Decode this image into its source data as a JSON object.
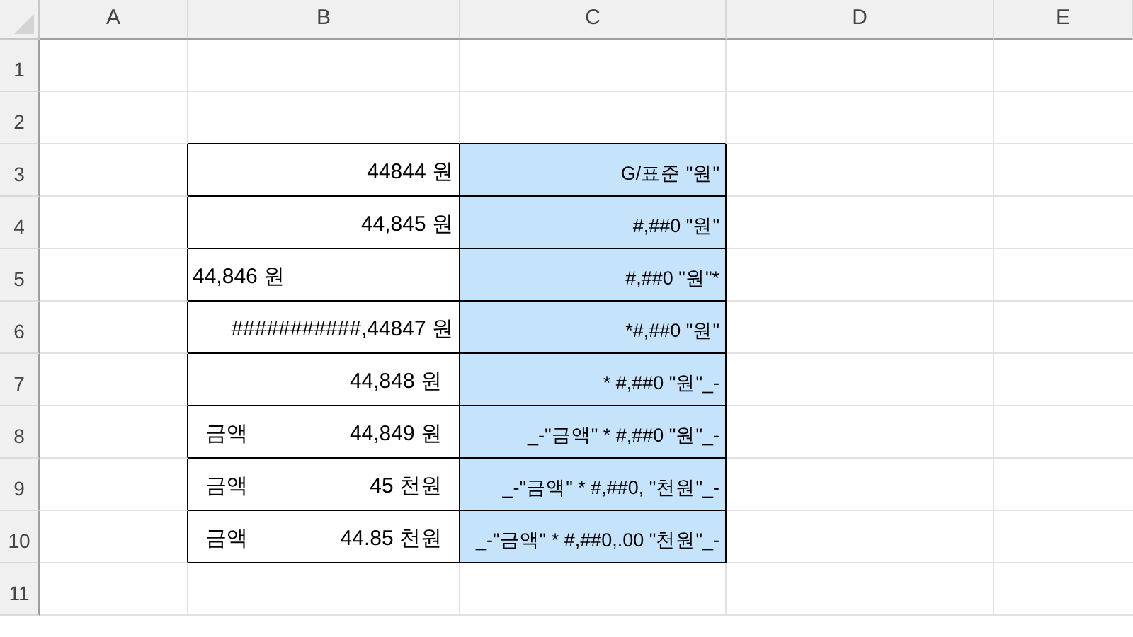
{
  "columns": [
    "A",
    "B",
    "C",
    "D",
    "E"
  ],
  "rows": [
    {
      "number": "1"
    },
    {
      "number": "2"
    },
    {
      "number": "3",
      "b": {
        "kind": "right",
        "text": "44844 원"
      },
      "c": "G/표준 \"원\""
    },
    {
      "number": "4",
      "b": {
        "kind": "right",
        "text": "44,845 원"
      },
      "c": "#,##0 \"원\""
    },
    {
      "number": "5",
      "b": {
        "kind": "left",
        "text": "44,846 원"
      },
      "c": "#,##0 \"원\"*"
    },
    {
      "number": "6",
      "b": {
        "kind": "right",
        "text": "###########,44847 원"
      },
      "c": "*#,##0 \"원\""
    },
    {
      "number": "7",
      "b": {
        "kind": "accounting",
        "text": "44,848 원"
      },
      "c": "* #,##0 \"원\"_-"
    },
    {
      "number": "8",
      "b": {
        "kind": "split",
        "label": "금액",
        "text": "44,849 원"
      },
      "c": "_-\"금액\" * #,##0 \"원\"_-"
    },
    {
      "number": "9",
      "b": {
        "kind": "split",
        "label": "금액",
        "text": "45 천원"
      },
      "c": "_-\"금액\" * #,##0, \"천원\"_-"
    },
    {
      "number": "10",
      "b": {
        "kind": "split",
        "label": "금액",
        "text": "44.85 천원"
      },
      "c": "_-\"금액\" * #,##0,.00 \"천원\"_-"
    },
    {
      "number": "11"
    }
  ]
}
